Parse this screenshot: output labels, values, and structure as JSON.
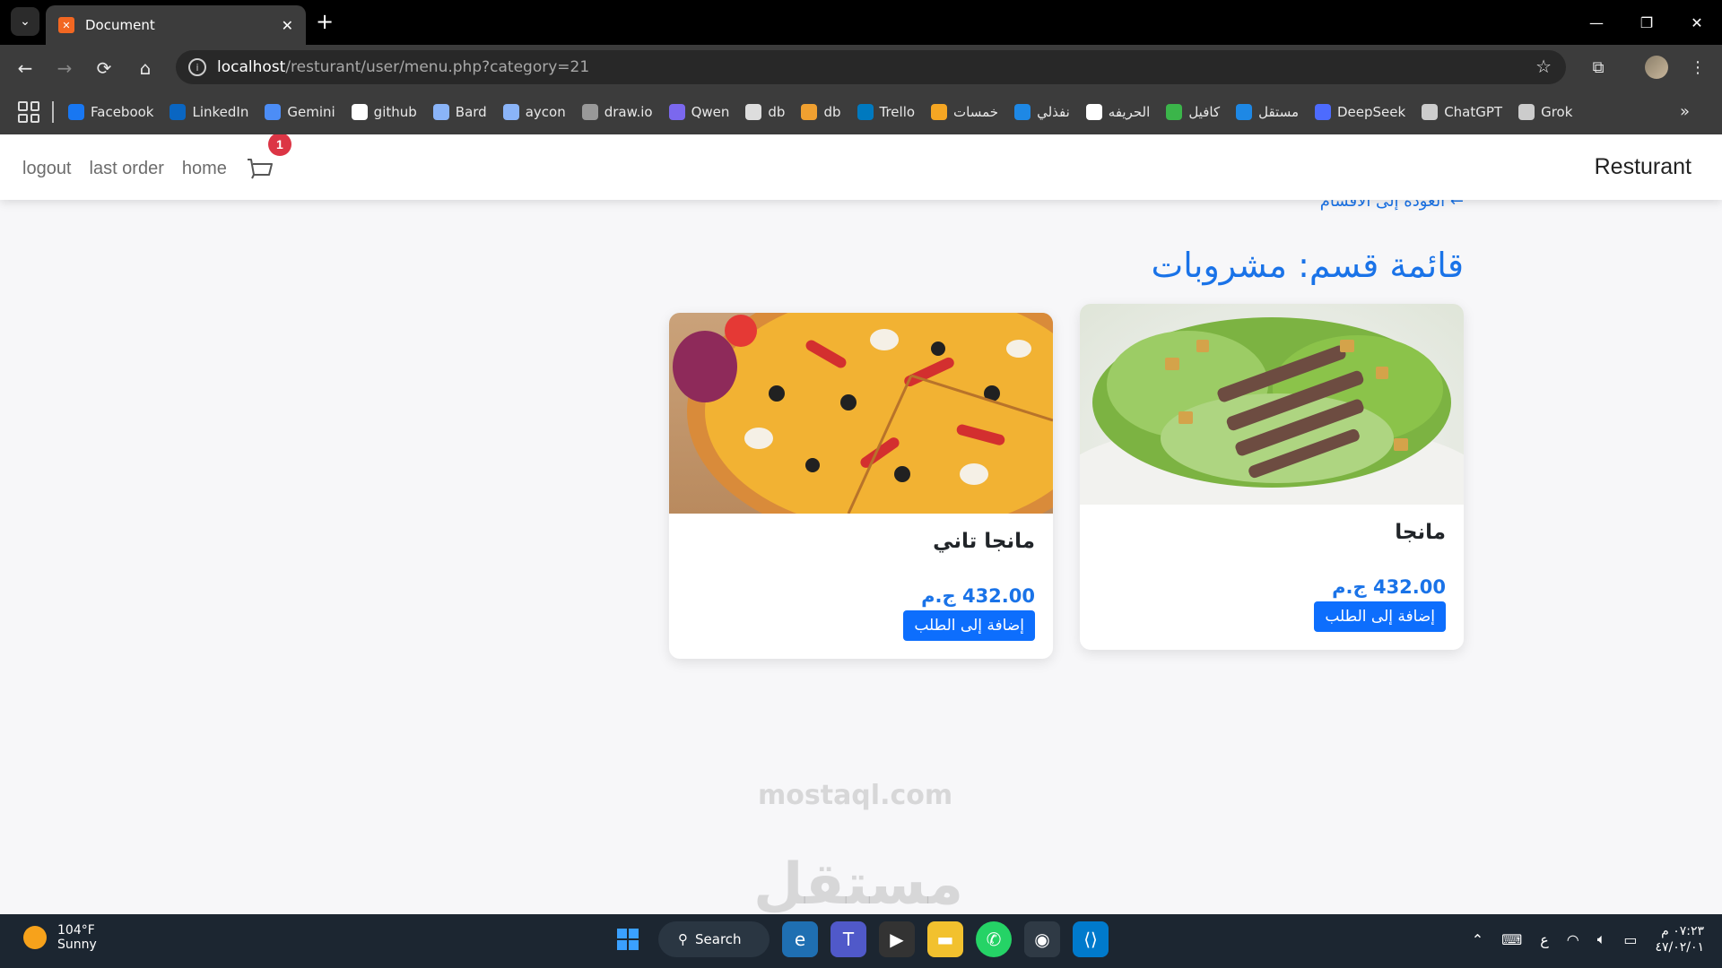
{
  "browser": {
    "tab_title": "Document",
    "url_host": "localhost",
    "url_path": "/resturant/user/menu.php?category=21"
  },
  "bookmarks": [
    {
      "label": "Facebook",
      "icon": "facebook-icon",
      "color": "#1877f2"
    },
    {
      "label": "LinkedIn",
      "icon": "linkedin-icon",
      "color": "#0a66c2"
    },
    {
      "label": "Gemini",
      "icon": "gemini-icon",
      "color": "#4c8df6"
    },
    {
      "label": "github",
      "icon": "github-icon",
      "color": "#ffffff"
    },
    {
      "label": "Bard",
      "icon": "bard-icon",
      "color": "#8ab4f8"
    },
    {
      "label": "aycon",
      "icon": "flag-icon",
      "color": "#8ab4f8"
    },
    {
      "label": "draw.io",
      "icon": "drawio-icon",
      "color": "#999999"
    },
    {
      "label": "Qwen",
      "icon": "qwen-icon",
      "color": "#7b68ee"
    },
    {
      "label": "db",
      "icon": "db-icon",
      "color": "#dddddd"
    },
    {
      "label": "db",
      "icon": "db-icon",
      "color": "#f0a030"
    },
    {
      "label": "Trello",
      "icon": "trello-icon",
      "color": "#0079bf"
    },
    {
      "label": "خمسات",
      "icon": "khamsat-icon",
      "color": "#f5a623"
    },
    {
      "label": "نفذلي",
      "icon": "nafzly-icon",
      "color": "#1e88e5"
    },
    {
      "label": "الحريفه",
      "icon": "harifa-icon",
      "color": "#ffffff"
    },
    {
      "label": "كافيل",
      "icon": "kafiil-icon",
      "color": "#3bb54a"
    },
    {
      "label": "مستقل",
      "icon": "mostaql-icon",
      "color": "#1e88e5"
    },
    {
      "label": "DeepSeek",
      "icon": "deepseek-icon",
      "color": "#4d6bfe"
    },
    {
      "label": "ChatGPT",
      "icon": "chatgpt-icon",
      "color": "#cccccc"
    },
    {
      "label": "Grok",
      "icon": "grok-icon",
      "color": "#cccccc"
    }
  ],
  "navbar": {
    "logout": "logout",
    "last_order": "last order",
    "home": "home",
    "cart_count": "1",
    "brand": "Resturant"
  },
  "page": {
    "back_link": "← العودة إلى الأقسام",
    "title": "قائمة قسم: مشروبات"
  },
  "products": [
    {
      "name": "مانجا",
      "price": "432.00 ج.م",
      "button": "إضافة إلى الطلب",
      "image": "salad-image"
    },
    {
      "name": "مانجا تاني",
      "price": "432.00 ج.م",
      "button": "إضافة إلى الطلب",
      "image": "pizza-image"
    }
  ],
  "watermark": {
    "main": "مستقل",
    "sub": "mostaql.com"
  },
  "taskbar": {
    "temperature": "104°F",
    "condition": "Sunny",
    "search": "Search",
    "ime": "ع",
    "time": "٠٧:٢٣ م",
    "date": "٤٧/٠٢/٠١"
  }
}
